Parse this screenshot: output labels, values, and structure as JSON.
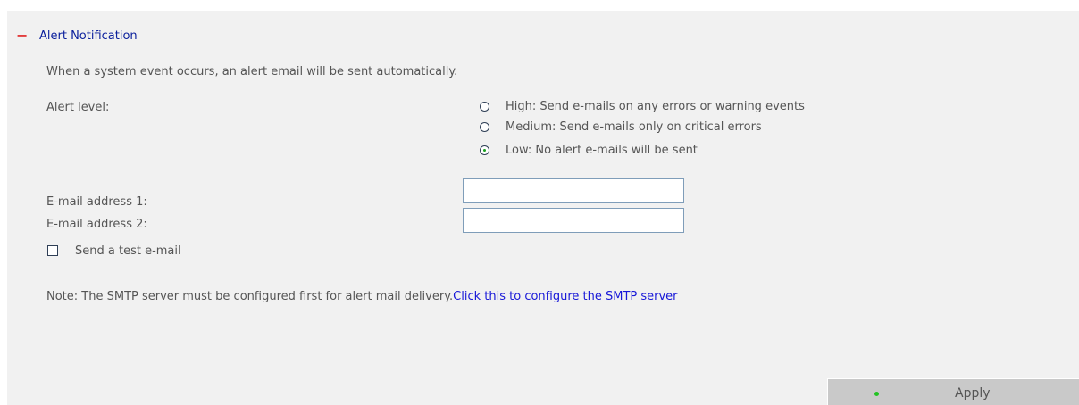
{
  "section": {
    "title": "Alert Notification",
    "description": "When a system event occurs, an alert email will be sent automatically."
  },
  "alert_level": {
    "label": "Alert level:",
    "options": [
      {
        "label": "High: Send e-mails on any errors or warning events",
        "selected": false
      },
      {
        "label": "Medium: Send e-mails only on critical errors",
        "selected": false
      },
      {
        "label": "Low: No alert e-mails will be sent",
        "selected": true
      }
    ]
  },
  "email": {
    "address1_label": "E-mail address 1:",
    "address1_value": "",
    "address2_label": "E-mail address 2:",
    "address2_value": ""
  },
  "test_email": {
    "label": "Send a test e-mail",
    "checked": false
  },
  "note": {
    "text": "Note: The SMTP server must be configured first for alert mail delivery.",
    "link": "Click this to configure the SMTP server"
  },
  "apply_button": {
    "label": "Apply"
  }
}
